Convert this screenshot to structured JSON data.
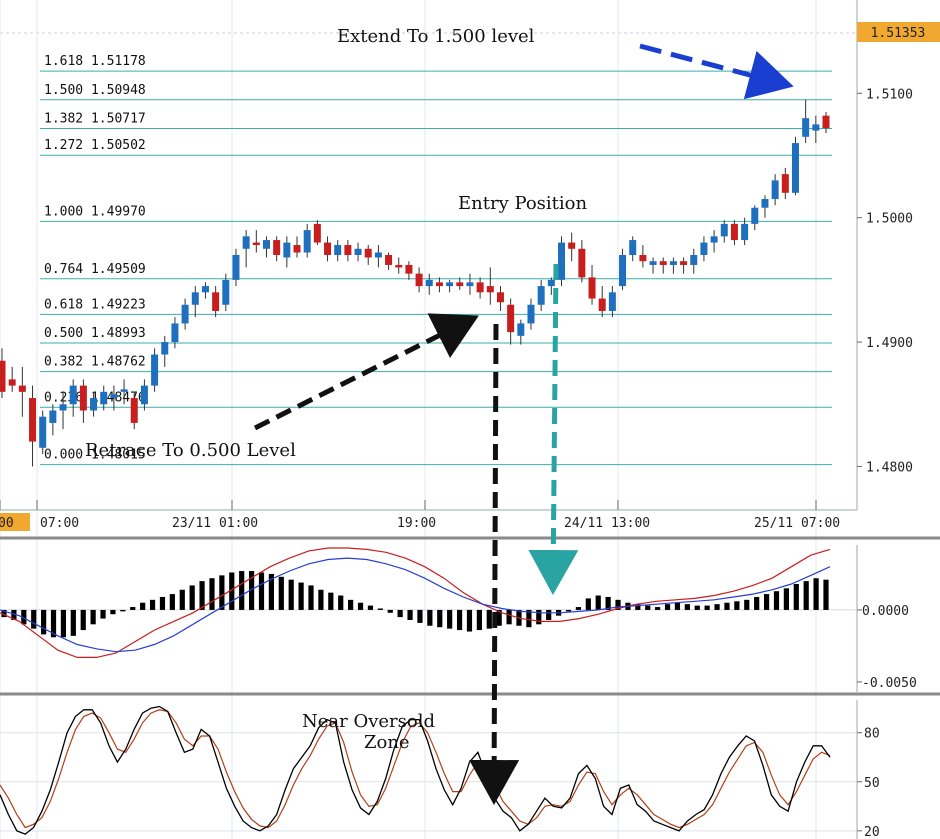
{
  "chart_data": [
    {
      "type": "candlestick",
      "panel": "price",
      "current_price_label": "1.51353",
      "y_ticks": [
        "1.5100",
        "1.5000",
        "1.4900",
        "1.4800"
      ],
      "y_tick_values": [
        1.51,
        1.5,
        1.49,
        1.48
      ],
      "ylim": [
        1.4765,
        1.5175
      ],
      "x_ticks": [
        "00",
        "07:00",
        "23/11 01:00",
        "19:00",
        "24/11 13:00",
        "25/11 07:00"
      ],
      "fib_levels": [
        {
          "ratio": "1.618",
          "price": "1.51178",
          "value": 1.51178
        },
        {
          "ratio": "1.500",
          "price": "1.50948",
          "value": 1.50948
        },
        {
          "ratio": "1.382",
          "price": "1.50717",
          "value": 1.50717
        },
        {
          "ratio": "1.272",
          "price": "1.50502",
          "value": 1.50502
        },
        {
          "ratio": "1.000",
          "price": "1.49970",
          "value": 1.4997
        },
        {
          "ratio": "0.764",
          "price": "1.49509",
          "value": 1.49509
        },
        {
          "ratio": "0.618",
          "price": "1.49223",
          "value": 1.49223
        },
        {
          "ratio": "0.500",
          "price": "1.48993",
          "value": 1.48993
        },
        {
          "ratio": "0.382",
          "price": "1.48762",
          "value": 1.48762
        },
        {
          "ratio": "0.236",
          "price": "1.48476",
          "value": 1.48476
        },
        {
          "ratio": "0.000",
          "price": "1.48015",
          "value": 1.48015
        }
      ],
      "candles": [
        [
          1.4885,
          1.4895,
          1.4855,
          1.486
        ],
        [
          1.487,
          1.488,
          1.486,
          1.4865
        ],
        [
          1.4865,
          1.488,
          1.484,
          1.486
        ],
        [
          1.4855,
          1.4865,
          1.48,
          1.482
        ],
        [
          1.4815,
          1.4845,
          1.481,
          1.484
        ],
        [
          1.4835,
          1.485,
          1.4825,
          1.4845
        ],
        [
          1.4845,
          1.486,
          1.483,
          1.485
        ],
        [
          1.485,
          1.487,
          1.484,
          1.4865
        ],
        [
          1.4865,
          1.487,
          1.4835,
          1.4845
        ],
        [
          1.4845,
          1.486,
          1.484,
          1.4855
        ],
        [
          1.485,
          1.4865,
          1.4845,
          1.486
        ],
        [
          1.4855,
          1.4865,
          1.4845,
          1.4858
        ],
        [
          1.486,
          1.487,
          1.485,
          1.4862
        ],
        [
          1.4855,
          1.486,
          1.483,
          1.4835
        ],
        [
          1.485,
          1.487,
          1.4845,
          1.4865
        ],
        [
          1.4865,
          1.4895,
          1.486,
          1.489
        ],
        [
          1.489,
          1.4905,
          1.488,
          1.49
        ],
        [
          1.49,
          1.492,
          1.4895,
          1.4915
        ],
        [
          1.4915,
          1.4935,
          1.491,
          1.493
        ],
        [
          1.493,
          1.4945,
          1.492,
          1.494
        ],
        [
          1.494,
          1.4948,
          1.4935,
          1.4945
        ],
        [
          1.494,
          1.4945,
          1.492,
          1.4925
        ],
        [
          1.493,
          1.4955,
          1.4925,
          1.495
        ],
        [
          1.495,
          1.4975,
          1.4945,
          1.497
        ],
        [
          1.4975,
          1.499,
          1.496,
          1.4985
        ],
        [
          1.498,
          1.499,
          1.4972,
          1.4978
        ],
        [
          1.4975,
          1.4985,
          1.4968,
          1.4982
        ],
        [
          1.4982,
          1.4985,
          1.4965,
          1.497
        ],
        [
          1.4968,
          1.4985,
          1.496,
          1.498
        ],
        [
          1.4978,
          1.4985,
          1.4968,
          1.4972
        ],
        [
          1.4972,
          1.4995,
          1.4968,
          1.499
        ],
        [
          1.4995,
          1.4998,
          1.4978,
          1.498
        ],
        [
          1.498,
          1.4985,
          1.4965,
          1.497
        ],
        [
          1.497,
          1.4982,
          1.4965,
          1.4978
        ],
        [
          1.4978,
          1.4982,
          1.4965,
          1.497
        ],
        [
          1.497,
          1.498,
          1.4965,
          1.4975
        ],
        [
          1.4975,
          1.4978,
          1.4962,
          1.4968
        ],
        [
          1.4968,
          1.4978,
          1.496,
          1.4972
        ],
        [
          1.497,
          1.4972,
          1.4958,
          1.4962
        ],
        [
          1.4962,
          1.4968,
          1.4955,
          1.496
        ],
        [
          1.4962,
          1.4965,
          1.495,
          1.4955
        ],
        [
          1.4955,
          1.496,
          1.494,
          1.4945
        ],
        [
          1.4945,
          1.4955,
          1.4938,
          1.495
        ],
        [
          1.4948,
          1.4952,
          1.494,
          1.4945
        ],
        [
          1.4945,
          1.495,
          1.494,
          1.4948
        ],
        [
          1.4948,
          1.4952,
          1.4942,
          1.4945
        ],
        [
          1.4945,
          1.4955,
          1.4938,
          1.4948
        ],
        [
          1.4948,
          1.4952,
          1.4935,
          1.494
        ],
        [
          1.4945,
          1.496,
          1.493,
          1.494
        ],
        [
          1.494,
          1.4945,
          1.4925,
          1.4932
        ],
        [
          1.493,
          1.4935,
          1.4898,
          1.4908
        ],
        [
          1.4905,
          1.4918,
          1.4898,
          1.4915
        ],
        [
          1.4915,
          1.4935,
          1.491,
          1.493
        ],
        [
          1.493,
          1.495,
          1.4925,
          1.4945
        ],
        [
          1.4945,
          1.4952,
          1.4938,
          1.495
        ],
        [
          1.495,
          1.4985,
          1.4945,
          1.498
        ],
        [
          1.498,
          1.4988,
          1.4965,
          1.4975
        ],
        [
          1.4975,
          1.4982,
          1.4948,
          1.4952
        ],
        [
          1.4952,
          1.4962,
          1.493,
          1.4935
        ],
        [
          1.4935,
          1.4945,
          1.492,
          1.4925
        ],
        [
          1.4925,
          1.4945,
          1.492,
          1.494
        ],
        [
          1.4945,
          1.4975,
          1.4942,
          1.497
        ],
        [
          1.497,
          1.4985,
          1.4965,
          1.4982
        ],
        [
          1.497,
          1.4978,
          1.496,
          1.4965
        ],
        [
          1.4962,
          1.4968,
          1.4955,
          1.4965
        ],
        [
          1.4965,
          1.4968,
          1.4955,
          1.4962
        ],
        [
          1.4962,
          1.4968,
          1.4955,
          1.4965
        ],
        [
          1.4965,
          1.4968,
          1.4955,
          1.4962
        ],
        [
          1.4962,
          1.4975,
          1.4955,
          1.497
        ],
        [
          1.497,
          1.4985,
          1.4965,
          1.498
        ],
        [
          1.498,
          1.499,
          1.4972,
          1.4985
        ],
        [
          1.4985,
          1.4998,
          1.498,
          1.4995
        ],
        [
          1.4995,
          1.4998,
          1.4978,
          1.4982
        ],
        [
          1.4982,
          1.5,
          1.4978,
          1.4995
        ],
        [
          1.4995,
          1.501,
          1.499,
          1.5008
        ],
        [
          1.5008,
          1.5018,
          1.5,
          1.5015
        ],
        [
          1.5015,
          1.5035,
          1.501,
          1.503
        ],
        [
          1.5035,
          1.504,
          1.5015,
          1.502
        ],
        [
          1.502,
          1.5065,
          1.5018,
          1.506
        ],
        [
          1.5065,
          1.5095,
          1.506,
          1.508
        ],
        [
          1.507,
          1.5082,
          1.506,
          1.5075
        ],
        [
          1.5082,
          1.5085,
          1.5068,
          1.5072
        ]
      ]
    },
    {
      "type": "macd",
      "panel": "macd",
      "y_ticks": [
        "0.0000",
        "-0.0050"
      ],
      "y_tick_values": [
        0.0,
        -0.005
      ],
      "ylim": [
        -0.0057,
        0.0043
      ],
      "histogram": [
        -0.0005,
        -0.0007,
        -0.001,
        -0.0013,
        -0.0017,
        -0.0019,
        -0.0019,
        -0.0018,
        -0.0014,
        -0.001,
        -0.0006,
        -0.0003,
        -0.0001,
        0.0002,
        0.0005,
        0.0007,
        0.0009,
        0.0011,
        0.0014,
        0.0017,
        0.002,
        0.0022,
        0.0024,
        0.0026,
        0.0027,
        0.0027,
        0.0026,
        0.0025,
        0.0023,
        0.0021,
        0.0019,
        0.0017,
        0.0014,
        0.0012,
        0.001,
        0.0007,
        0.0005,
        0.0003,
        0.0001,
        -0.0002,
        -0.0005,
        -0.0007,
        -0.0009,
        -0.0011,
        -0.0012,
        -0.0013,
        -0.0014,
        -0.0015,
        -0.0014,
        -0.0013,
        -0.0011,
        -0.001,
        -0.0011,
        -0.0012,
        -0.001,
        -0.0007,
        -0.0004,
        -0.0001,
        0.0002,
        0.0008,
        0.001,
        0.0009,
        0.0007,
        0.0005,
        0.0004,
        0.0003,
        0.0002,
        0.0004,
        0.0005,
        0.0004,
        0.0003,
        0.0003,
        0.0004,
        0.0005,
        0.0006,
        0.0007,
        0.0009,
        0.0011,
        0.0013,
        0.0015,
        0.0018,
        0.002,
        0.0022,
        0.0021
      ],
      "signal_red": [
        -0.0002,
        -0.0008,
        -0.0018,
        -0.0028,
        -0.0033,
        -0.0033,
        -0.003,
        -0.0022,
        -0.0014,
        -0.0008,
        -0.0002,
        0.0006,
        0.0014,
        0.0022,
        0.003,
        0.0036,
        0.0041,
        0.0043,
        0.0043,
        0.0042,
        0.004,
        0.0036,
        0.003,
        0.0022,
        0.0012,
        0.0004,
        -0.0002,
        -0.0006,
        -0.0008,
        -0.0008,
        -0.0006,
        -0.0003,
        0.0001,
        0.0004,
        0.0006,
        0.0007,
        0.0008,
        0.001,
        0.0013,
        0.0017,
        0.0022,
        0.003,
        0.0038,
        0.0042
      ],
      "signal_blue": [
        0.0,
        -0.0004,
        -0.0011,
        -0.0018,
        -0.0024,
        -0.0027,
        -0.0029,
        -0.0028,
        -0.0024,
        -0.0018,
        -0.001,
        -0.0002,
        0.0006,
        0.0014,
        0.0021,
        0.0027,
        0.0032,
        0.0035,
        0.0036,
        0.0035,
        0.0032,
        0.0028,
        0.0022,
        0.0015,
        0.0009,
        0.0004,
        0.0001,
        -0.0001,
        -0.0002,
        -0.0002,
        -0.0001,
        0.0,
        0.0002,
        0.0003,
        0.0004,
        0.0005,
        0.0006,
        0.0007,
        0.0009,
        0.0011,
        0.0014,
        0.0018,
        0.0024,
        0.003
      ]
    },
    {
      "type": "stochastic",
      "panel": "stochastic",
      "y_ticks": [
        "80",
        "50",
        "20"
      ],
      "y_tick_values": [
        80,
        50,
        20
      ],
      "ylim": [
        15,
        100
      ],
      "k_line": [
        42,
        30,
        20,
        18,
        22,
        32,
        45,
        62,
        80,
        90,
        94,
        94,
        86,
        72,
        62,
        70,
        82,
        92,
        95,
        96,
        93,
        80,
        68,
        70,
        82,
        78,
        62,
        46,
        35,
        26,
        22,
        20,
        23,
        30,
        45,
        58,
        65,
        72,
        83,
        88,
        86,
        62,
        45,
        34,
        30,
        38,
        52,
        70,
        84,
        88,
        88,
        75,
        58,
        45,
        36,
        46,
        62,
        68,
        54,
        40,
        32,
        28,
        20,
        24,
        32,
        40,
        35,
        34,
        40,
        55,
        60,
        52,
        35,
        30,
        46,
        48,
        36,
        32,
        26,
        24,
        22,
        20,
        26,
        30,
        33,
        42,
        55,
        65,
        72,
        78,
        75,
        60,
        42,
        35,
        32,
        50,
        62,
        72,
        72,
        65
      ],
      "d_line": [
        48,
        40,
        30,
        22,
        24,
        28,
        38,
        52,
        68,
        82,
        90,
        92,
        89,
        80,
        70,
        68,
        76,
        86,
        92,
        94,
        93,
        86,
        76,
        72,
        78,
        78,
        70,
        56,
        44,
        34,
        27,
        23,
        22,
        26,
        36,
        48,
        58,
        66,
        76,
        84,
        86,
        74,
        56,
        42,
        35,
        36,
        46,
        60,
        74,
        84,
        86,
        80,
        68,
        55,
        44,
        44,
        54,
        62,
        58,
        48,
        38,
        32,
        26,
        24,
        28,
        35,
        36,
        35,
        38,
        48,
        56,
        55,
        44,
        36,
        42,
        46,
        42,
        36,
        30,
        27,
        24,
        22,
        24,
        27,
        30,
        36,
        46,
        56,
        64,
        72,
        74,
        68,
        54,
        42,
        36,
        44,
        54,
        64,
        68,
        66
      ]
    }
  ],
  "annotations": {
    "extend": "Extend To 1.500 level",
    "entry": "Entry Position",
    "retrace": "Retrace To 0.500 Level",
    "oversold_line1": "Near Oversold",
    "oversold_line2": "Zone"
  },
  "colors": {
    "bull": "#1f6fbf",
    "bear": "#c81e1e",
    "fib_line": "#3aaeb0",
    "price_badge": "#f0a830",
    "blue_arrow": "#1a3fd0",
    "black_arrow": "#111111",
    "teal_arrow": "#2aa3a3",
    "macd_red": "#c81e1e",
    "macd_blue": "#2a3fd0",
    "stoch_black": "#000000",
    "stoch_brown": "#b0401a"
  }
}
